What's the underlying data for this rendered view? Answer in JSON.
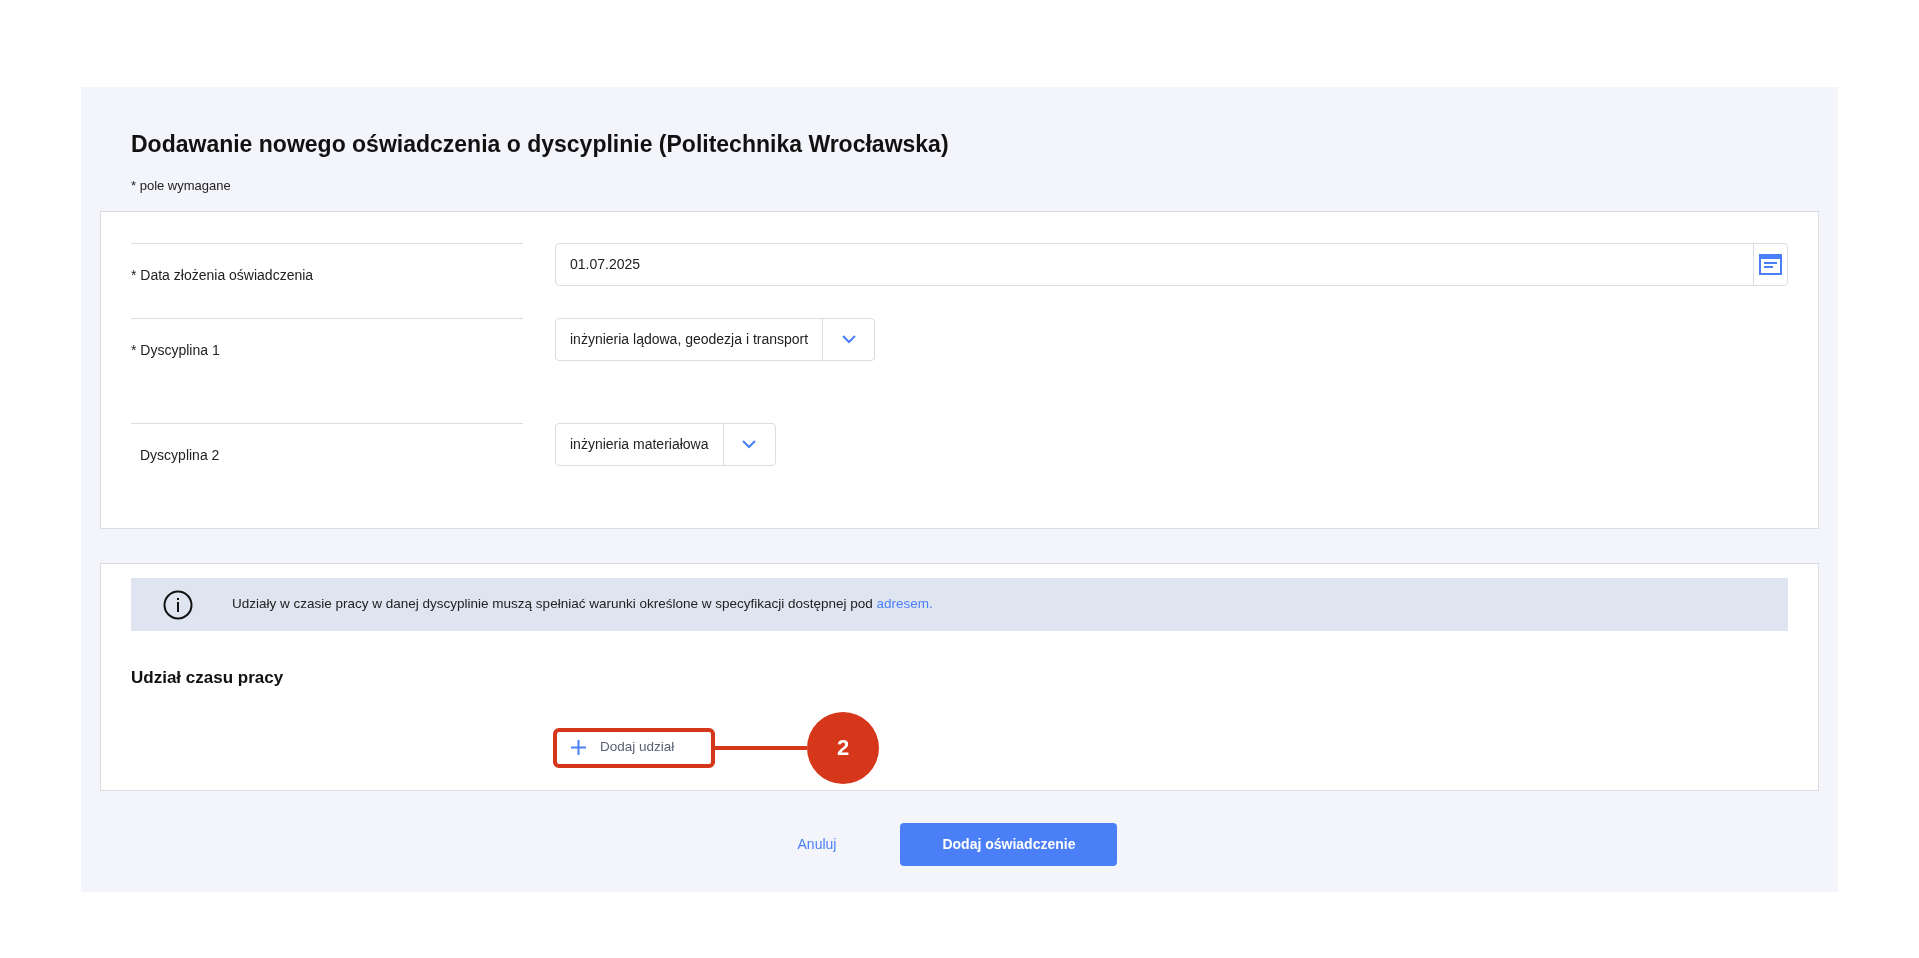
{
  "title": "Dodawanie nowego oświadczenia o dyscyplinie (Politechnika Wrocławska)",
  "required_note": "* pole wymagane",
  "fields": [
    {
      "kind": "date",
      "label": "* Data złożenia oświadczenia",
      "value": "01.07.2025"
    },
    {
      "kind": "select",
      "label": "* Dyscyplina 1",
      "value": "inżynieria lądowa, geodezja i transport"
    },
    {
      "kind": "select",
      "label": "Dyscyplina 2",
      "value": "inżynieria materiałowa"
    }
  ],
  "info": {
    "text": "Udziały w czasie pracy w danej dyscyplinie muszą spełniać warunki określone w specyfikacji dostępnej pod",
    "link": "adresem."
  },
  "section_title": "Udział czasu pracy",
  "add_button": "Dodaj udział",
  "callout": "2",
  "cancel_button": "Anuluj",
  "submit_button": "Dodaj oświadczenie"
}
